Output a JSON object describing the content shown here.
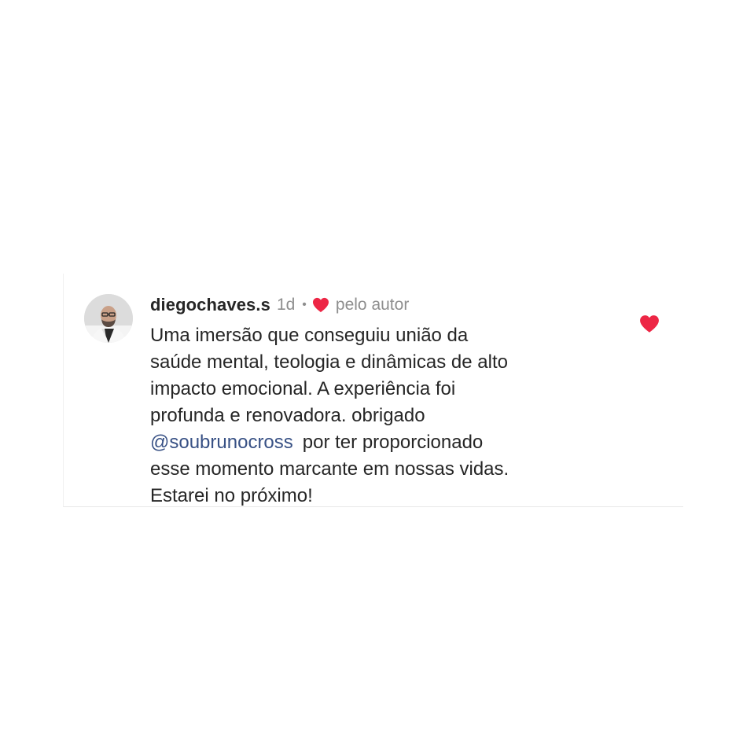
{
  "comment": {
    "username": "diegochaves.s",
    "time": "1d",
    "separator": "•",
    "liked_by_author_label": "pelo autor",
    "lines": [
      "Uma imersão que conseguiu união da",
      "saúde mental, teologia e dinâmicas de alto",
      "impacto emocional. A experiência foi",
      "profunda e renovadora. obrigado"
    ],
    "mention": "@soubrunocross",
    "after_mention": "por ter proporcionado",
    "lines_end": [
      "esse momento marcante em nossas vidas.",
      "Estarei no próximo!"
    ],
    "liked": true
  },
  "colors": {
    "heart": "#ed2645",
    "username": "#262626",
    "meta_text": "#8e8e8e",
    "mention": "#385185",
    "body_text": "#262626"
  },
  "icons": {
    "author_like": "heart-icon",
    "like_button": "heart-icon"
  }
}
